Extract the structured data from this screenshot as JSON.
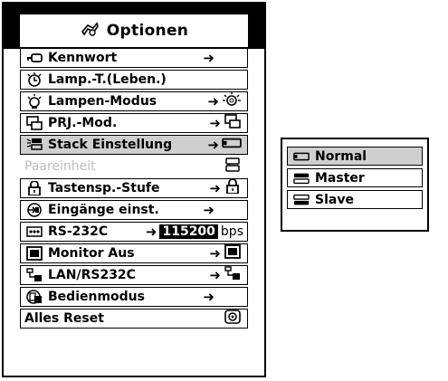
{
  "menu": {
    "title": "Optionen",
    "title_icon": "options-icon",
    "items": [
      {
        "label": "Kennwort",
        "icon": "key-icon",
        "arrow": "➜",
        "value_icon": ""
      },
      {
        "label": "Lamp.-T.(Leben.)",
        "icon": "lamp-timer-icon",
        "arrow": "",
        "value_icon": ""
      },
      {
        "label": "Lampen-Modus",
        "icon": "lamp-icon",
        "arrow": "➜",
        "value_icon": "lamp-eco-icon"
      },
      {
        "label": "PRJ.-Mod.",
        "icon": "projection-mode-icon",
        "arrow": "➜",
        "value_icon": "projection-mode-icon"
      },
      {
        "label": "Stack Einstellung",
        "icon": "stack-icon",
        "arrow": "➜",
        "value_icon": "projector-normal-icon",
        "highlighted": true
      },
      {
        "label": "Paareinheit",
        "icon": "",
        "arrow": "",
        "value_icon": "projector-pair-icon",
        "disabled": true
      },
      {
        "label": "Tastensp.-Stufe",
        "icon": "padlock-icon",
        "arrow": "➜",
        "value_icon": "padlock-icon"
      },
      {
        "label": "Eingänge einst.",
        "icon": "input-select-icon",
        "arrow": "➜",
        "value_icon": ""
      },
      {
        "label": "RS-232C",
        "icon": "rs232c-port-icon",
        "arrow": "➜",
        "value": "115200",
        "unit": "bps"
      },
      {
        "label": "Monitor Aus",
        "icon": "monitor-icon",
        "arrow": "➜",
        "value_icon": "monitor-icon"
      },
      {
        "label": "LAN/RS232C",
        "icon": "lan-icon",
        "arrow": "➜",
        "value_icon": "lan-icon"
      },
      {
        "label": "Bedienmodus",
        "icon": "operation-mode-icon",
        "arrow": "➜",
        "value_icon": ""
      },
      {
        "label": "Alles Reset",
        "icon": "",
        "arrow": "",
        "value_icon": "reset-icon"
      }
    ]
  },
  "submenu": {
    "items": [
      {
        "label": "Normal",
        "icon": "projector-normal-icon",
        "selected": true
      },
      {
        "label": "Master",
        "icon": "projector-master-icon",
        "selected": false
      },
      {
        "label": "Slave",
        "icon": "projector-slave-icon",
        "selected": false
      }
    ]
  }
}
